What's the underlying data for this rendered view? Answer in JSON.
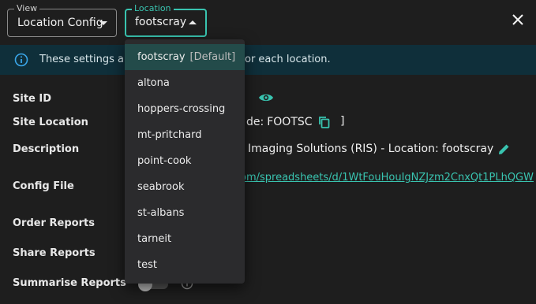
{
  "header": {
    "view_select": {
      "legend": "View",
      "value": "Location Config"
    },
    "location_select": {
      "legend": "Location",
      "value": "footscray"
    }
  },
  "banner": {
    "text_start": "These settings are",
    "text_end": "or each location."
  },
  "fields": {
    "site_id_label": "Site ID",
    "site_location_label": "Site Location",
    "site_code_prefix": "de:",
    "site_code_value": "FOOTSC",
    "site_code_bracket": "]",
    "description_label": "Description",
    "description_value": "Imaging Solutions (RIS) - Location: footscray",
    "config_file_label": "Config File",
    "config_file_link": "om/spreadsheets/d/1WtFouHouIgNZJzm2CnxQt1PLhQGW",
    "order_reports_label": "Order Reports",
    "share_reports_label": "Share Reports",
    "summarise_reports_label": "Summarise Reports"
  },
  "dropdown": {
    "items": [
      {
        "label": "footscray",
        "tag": "[Default]",
        "selected": true
      },
      {
        "label": "altona"
      },
      {
        "label": "hoppers-crossing"
      },
      {
        "label": "mt-pritchard"
      },
      {
        "label": "point-cook"
      },
      {
        "label": "seabrook"
      },
      {
        "label": "st-albans"
      },
      {
        "label": "tarneit"
      },
      {
        "label": "test"
      }
    ]
  },
  "colors": {
    "accent": "#39c4b0",
    "background": "#1e1e1e",
    "banner": "#0f2f3a",
    "menu": "#2b2b2d",
    "menu_selected": "#234b4a"
  },
  "icons": [
    "info-icon",
    "close-icon",
    "eye-icon",
    "copy-icon",
    "pencil-icon",
    "help-icon",
    "caret-down-icon",
    "caret-up-icon"
  ]
}
